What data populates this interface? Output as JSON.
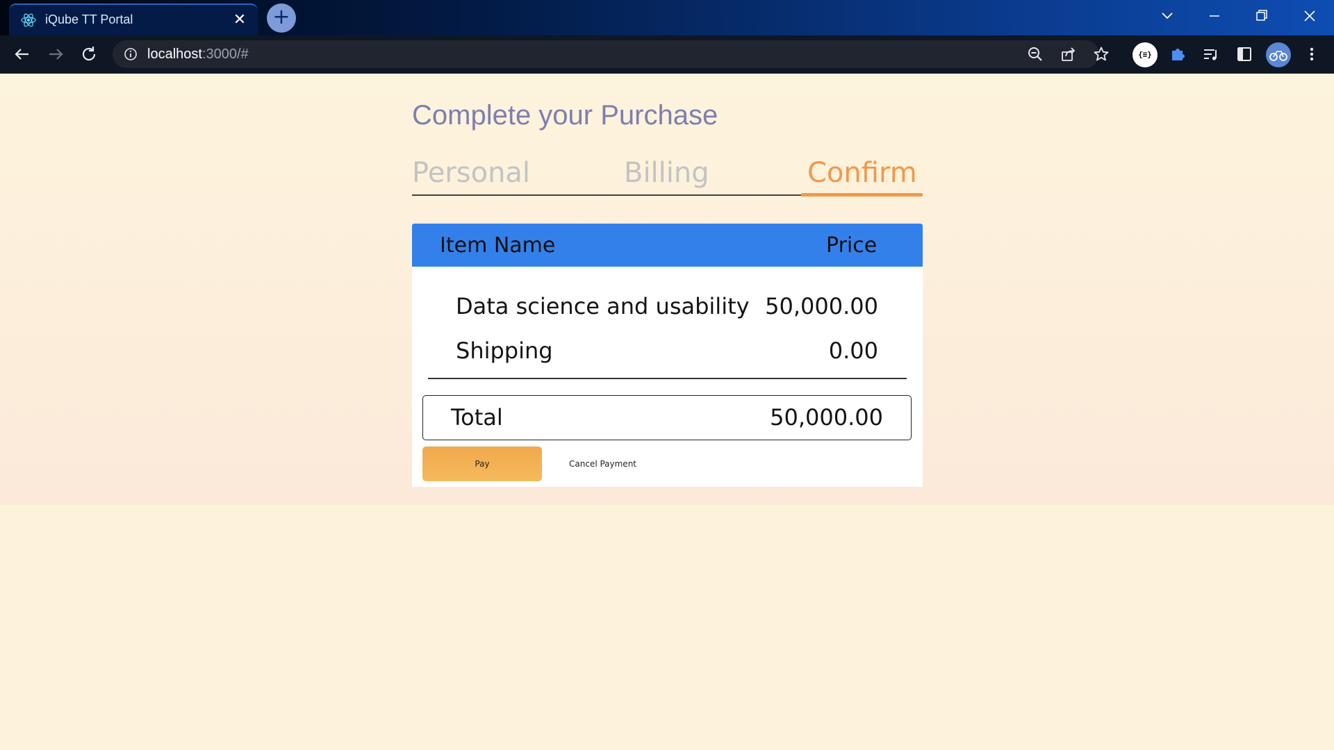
{
  "browser": {
    "tab_title": "iQube TT Portal",
    "tab_close": "✕",
    "new_tab": "+",
    "url_host": "localhost",
    "url_rest": ":3000/#",
    "extension_label": "{≡}"
  },
  "page": {
    "heading": "Complete your Purchase",
    "steps": [
      {
        "label": "Personal",
        "state": "inactive"
      },
      {
        "label": "Billing",
        "state": "inactive"
      },
      {
        "label": "Confirm",
        "state": "active"
      }
    ],
    "table": {
      "headers": {
        "item": "Item Name",
        "price": "Price"
      },
      "rows": [
        {
          "item": "Data science and usability",
          "price": "50,000.00"
        },
        {
          "item": "Shipping",
          "price": "0.00"
        }
      ],
      "total_label": "Total",
      "total_value": "50,000.00"
    },
    "actions": {
      "pay": "Pay",
      "cancel": "Cancel Payment"
    }
  },
  "colors": {
    "accent_orange": "#f29849",
    "header_blue": "#3380ea",
    "heading_purple": "#7d7fae",
    "step_inactive": "#c3c3c3"
  }
}
